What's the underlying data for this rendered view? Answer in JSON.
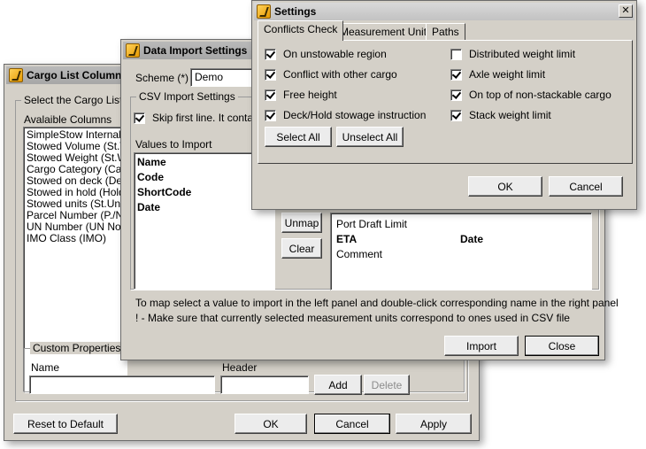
{
  "cargo_list_window": {
    "title": "Cargo List Columns",
    "select_group_label": "Select the Cargo List co",
    "available_columns_label": "Avalaible Columns",
    "available_columns": [
      "SimpleStow Internal Ca",
      "Stowed Volume (St.Vol",
      "Stowed Weight (St.Wg",
      "Cargo Category (Categ",
      "Stowed on deck (Deck",
      "Stowed in hold (Hold)",
      "Stowed units (St.Units)",
      "Parcel Number (P./N)",
      "UN Number (UN No.)",
      "IMO Class (IMO)"
    ],
    "custom_properties_label": "Custom Properties",
    "name_label": "Name",
    "header_label": "Header",
    "name_value": "",
    "header_value": "",
    "add_label": "Add",
    "delete_label": "Delete",
    "reset_label": "Reset to Default",
    "ok_label": "OK",
    "cancel_label": "Cancel",
    "apply_label": "Apply"
  },
  "import_window": {
    "title": "Data Import Settings",
    "scheme_label": "Scheme (*)",
    "scheme_value": "Demo",
    "csv_group_label": "CSV Import Settings",
    "skip_first_line_label": "Skip first line. It contains",
    "skip_first_line_checked": true,
    "values_to_import_label": "Values to Import",
    "values_to_import": [
      "Name",
      "Code",
      "ShortCode",
      "Date"
    ],
    "unmap_label": "Unmap",
    "clear_label": "Clear",
    "mapping_rows": [
      {
        "name": "Port Draft Limit",
        "value": "",
        "bold": false
      },
      {
        "name": "ETA",
        "value": "Date",
        "bold": true
      },
      {
        "name": "Comment",
        "value": "",
        "bold": false
      }
    ],
    "hint_1": "To map select a value to import in the left panel and double-click corresponding name in the right panel",
    "hint_2": "! - Make sure that currently selected measurement units correspond to ones used in CSV file",
    "import_label": "Import",
    "close_label": "Close"
  },
  "settings_window": {
    "title": "Settings",
    "tabs": [
      "Conflicts Check",
      "Measurement Units",
      "Paths"
    ],
    "active_tab": "Conflicts Check",
    "left_checks": [
      {
        "label": "On unstowable region",
        "checked": true
      },
      {
        "label": "Conflict with other cargo",
        "checked": true
      },
      {
        "label": "Free height",
        "checked": true
      },
      {
        "label": "Deck/Hold stowage instruction",
        "checked": true
      }
    ],
    "right_checks": [
      {
        "label": "Distributed weight limit",
        "checked": false
      },
      {
        "label": "Axle weight limit",
        "checked": true
      },
      {
        "label": "On top of non-stackable cargo",
        "checked": true
      },
      {
        "label": "Stack weight limit",
        "checked": true
      }
    ],
    "select_all_label": "Select All",
    "unselect_all_label": "Unselect All",
    "ok_label": "OK",
    "cancel_label": "Cancel"
  }
}
